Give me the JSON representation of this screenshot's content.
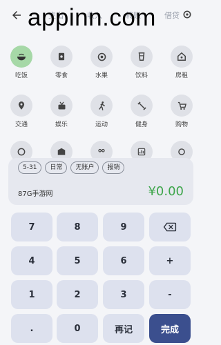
{
  "watermark": "appinn.com",
  "header": {
    "tabs": [
      "支出",
      "收入",
      "转账",
      "借贷"
    ]
  },
  "categories": [
    {
      "label": "吃饭",
      "icon": "bowl-icon",
      "active": true
    },
    {
      "label": "零食",
      "icon": "snack-icon"
    },
    {
      "label": "水果",
      "icon": "fruit-icon"
    },
    {
      "label": "饮料",
      "icon": "drink-icon"
    },
    {
      "label": "房租",
      "icon": "house-icon"
    },
    {
      "label": "交通",
      "icon": "location-icon"
    },
    {
      "label": "娱乐",
      "icon": "entertainment-icon"
    },
    {
      "label": "运动",
      "icon": "running-icon"
    },
    {
      "label": "健身",
      "icon": "fitness-icon"
    },
    {
      "label": "购物",
      "icon": "cart-icon"
    }
  ],
  "entry": {
    "chips": [
      "5-31",
      "日常",
      "无账户",
      "报销"
    ],
    "note": "87G手游网",
    "amount": "¥0.00",
    "amount_color": "#3da54a"
  },
  "keypad": {
    "keys": [
      [
        "7",
        "8",
        "9",
        "⌫"
      ],
      [
        "4",
        "5",
        "6",
        "+"
      ],
      [
        "1",
        "2",
        "3",
        "-"
      ],
      [
        ".",
        "0",
        "再记",
        "完成"
      ]
    ]
  }
}
